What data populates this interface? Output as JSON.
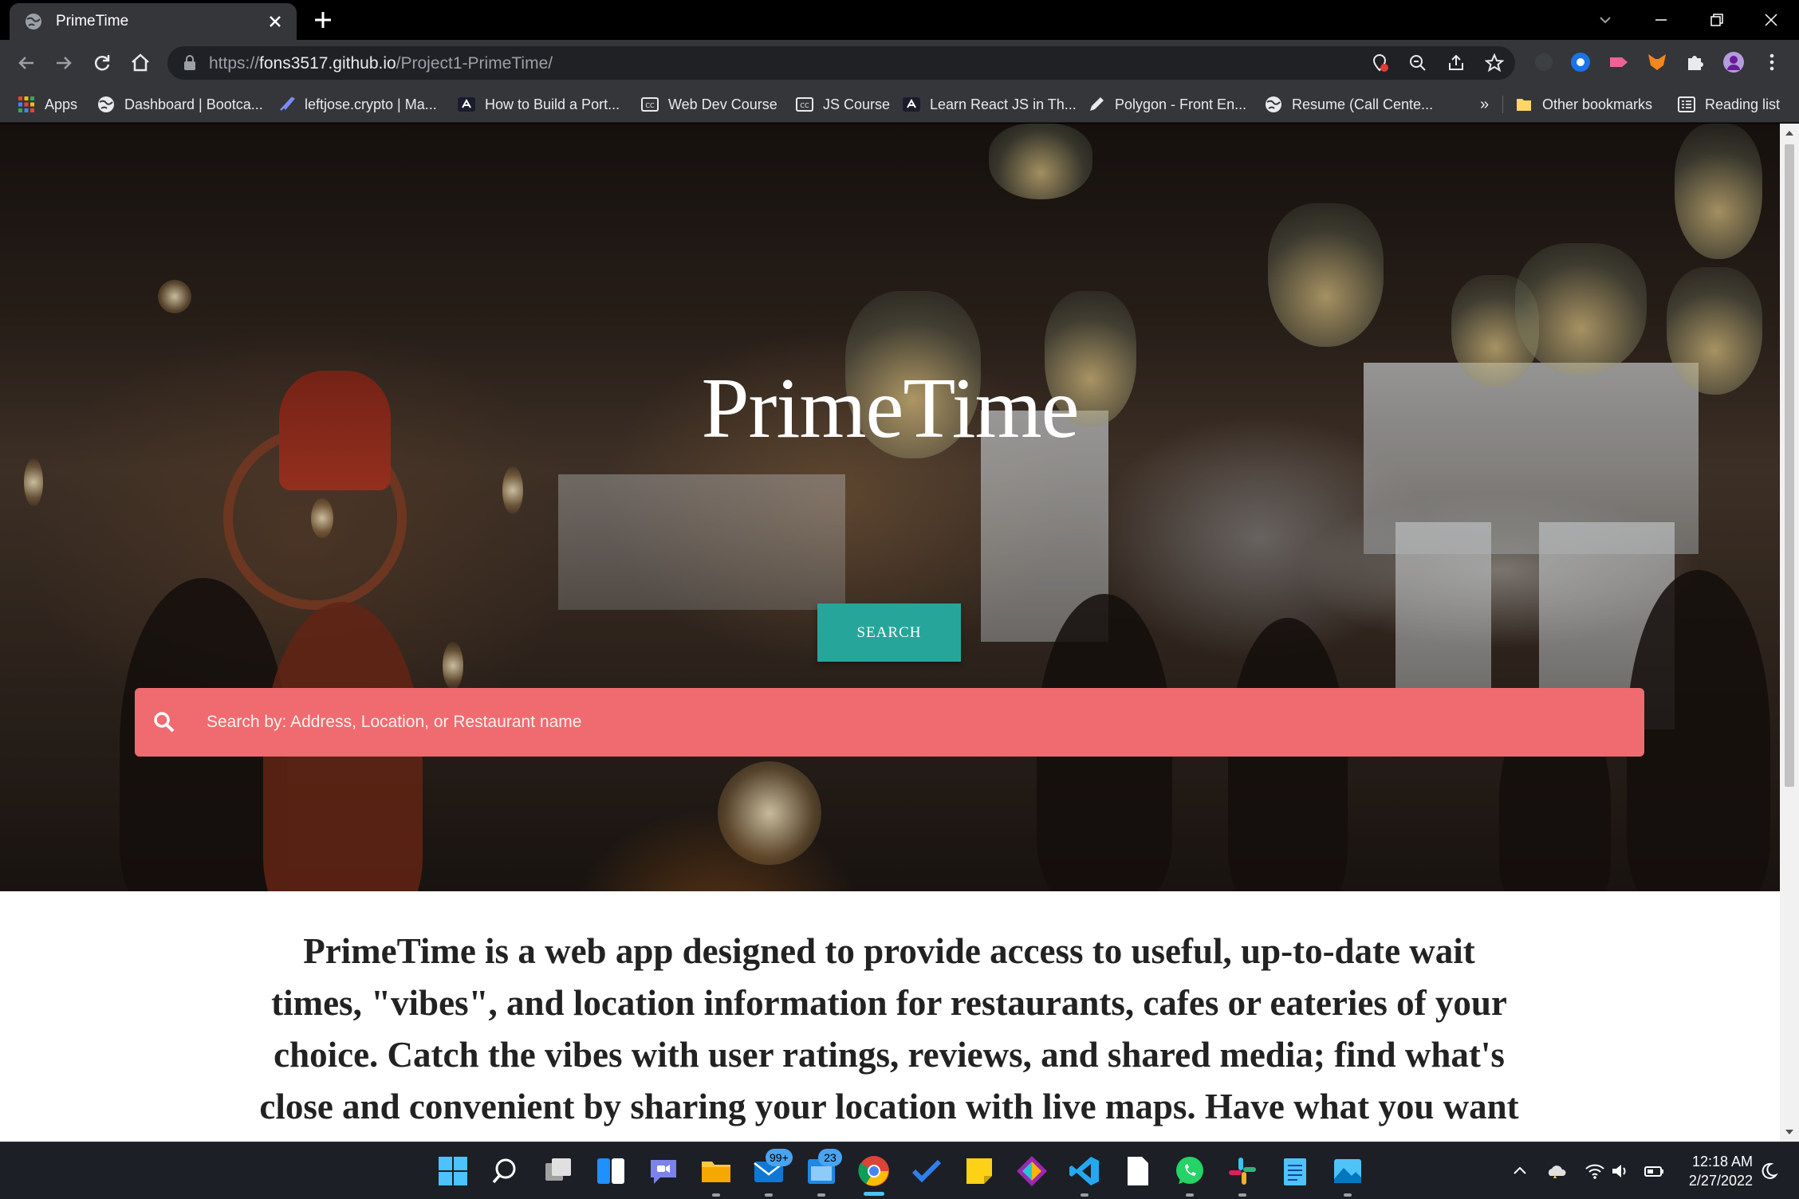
{
  "browser": {
    "tab_title": "PrimeTime",
    "url_prefix": "https://",
    "url_host": "fons3517.github.io",
    "url_path": "/Project1-PrimeTime/",
    "bookmarks": [
      {
        "label": "Apps",
        "icon": "apps-grid-icon"
      },
      {
        "label": "Dashboard | Bootca...",
        "icon": "globe-icon"
      },
      {
        "label": "leftjose.crypto | Ma...",
        "icon": "rocket-icon"
      },
      {
        "label": "How to Build a Port...",
        "icon": "academind-icon"
      },
      {
        "label": "Web Dev Course",
        "icon": "cc-icon"
      },
      {
        "label": "JS Course",
        "icon": "cc-icon"
      },
      {
        "label": "Learn React JS in Th...",
        "icon": "academind-icon"
      },
      {
        "label": "Polygon - Front En...",
        "icon": "pencil-icon"
      },
      {
        "label": "Resume (Call Cente...",
        "icon": "globe-icon"
      }
    ],
    "overflow_label": "»",
    "other_bookmarks": "Other bookmarks",
    "reading_list": "Reading list"
  },
  "hero": {
    "title": "PrimeTime",
    "search_button": "SEARCH",
    "search_placeholder": "Search by: Address, Location, or Restaurant name"
  },
  "about": {
    "text": "PrimeTime is a web app designed to provide access to useful, up-to-date wait times, \"vibes\", and location information for restaurants, cafes or eateries of your choice. Catch the vibes with user ratings, reviews, and shared media; find what's close and convenient by sharing your location with live maps. Have what you want when you"
  },
  "taskbar": {
    "mail_badge": "99+",
    "calendar_badge": "23",
    "time": "12:18 AM",
    "date": "2/27/2022"
  },
  "colors": {
    "search_button": "#26a69a",
    "search_bar": "#ef6b70",
    "chrome_toolbar": "#35363a"
  }
}
